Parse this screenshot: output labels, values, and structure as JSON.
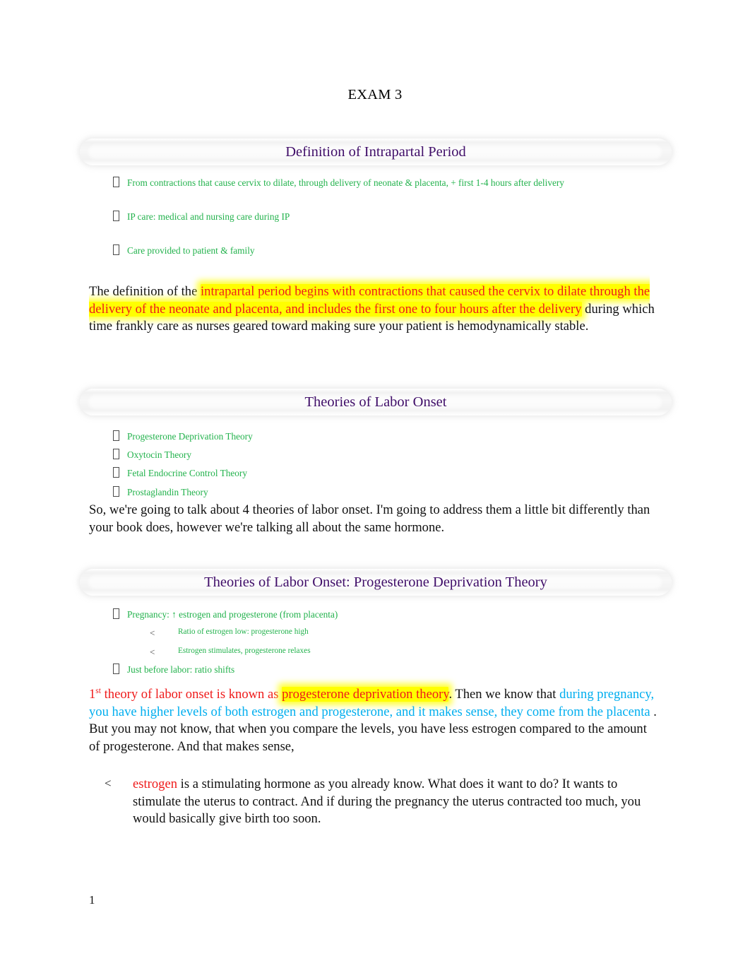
{
  "document": {
    "title": "EXAM 3",
    "page_number": "1"
  },
  "colors": {
    "heading_purple": "#3f0d68",
    "bullet_green": "#22b24c",
    "accent_red": "#ef1b1b",
    "accent_cyan": "#00aeef",
    "highlight_yellow": "#ffff00",
    "body_black": "#111111"
  },
  "sections": [
    {
      "heading": "Definition of Intrapartal Period",
      "bullets": [
        "From contractions that cause cervix to dilate, through delivery of neonate & placenta, + first 1-4 hours after delivery",
        "IP care: medical and nursing care during IP",
        "Care provided to patient & family"
      ],
      "narration": {
        "lead_plain": "The definition of the ",
        "highlight_red": "intrapartal period  begins with contractions that caused the cervix to dilate through the delivery of the neonate and placenta, and includes the first one to four hours after the delivery",
        "tail_plain": " during which time frankly care as nurses geared toward making sure your patient is hemodynamically stable."
      }
    },
    {
      "heading": "Theories of Labor Onset",
      "bullets": [
        "Progesterone Deprivation Theory",
        "Oxytocin Theory",
        "Fetal Endocrine Control Theory",
        "Prostaglandin Theory"
      ],
      "narration": {
        "plain": "So, we're going to talk about 4 theories of labor onset. I'm going to address them a little bit differently than your book does, however we're talking all about the same hormone."
      }
    },
    {
      "heading": "Theories of Labor Onset: Progesterone Deprivation Theory",
      "bullets": [
        {
          "text": "Pregnancy: ↑ estrogen and progesterone (from placenta)",
          "sub": [
            "Ratio of estrogen low: progesterone high",
            "Estrogen stimulates, progesterone relaxes"
          ]
        },
        {
          "text": "Just before labor: ratio shifts",
          "sub": []
        }
      ],
      "narration": {
        "ordinal_number": "1",
        "ordinal_suffix": "st",
        "red_lead": " theory of labor onset is known as ",
        "highlight_red": "progesterone deprivation theory",
        "plain_mid": ". Then we know that ",
        "cyan": "during pregnancy, you have higher levels of both estrogen and progesterone, and it makes sense, they come from the placenta",
        "plain_tail": " . But you may not know, that when you compare the levels, you have less estrogen compared to the amount of progesterone. And that makes sense,"
      },
      "narration_bullet": {
        "marker": "<",
        "red_word": "estrogen",
        "rest": " is a stimulating hormone as you already know. What does it want to do? It wants to stimulate the uterus to contract. And if during the pregnancy the uterus contracted too much, you would basically give birth too soon."
      }
    }
  ]
}
